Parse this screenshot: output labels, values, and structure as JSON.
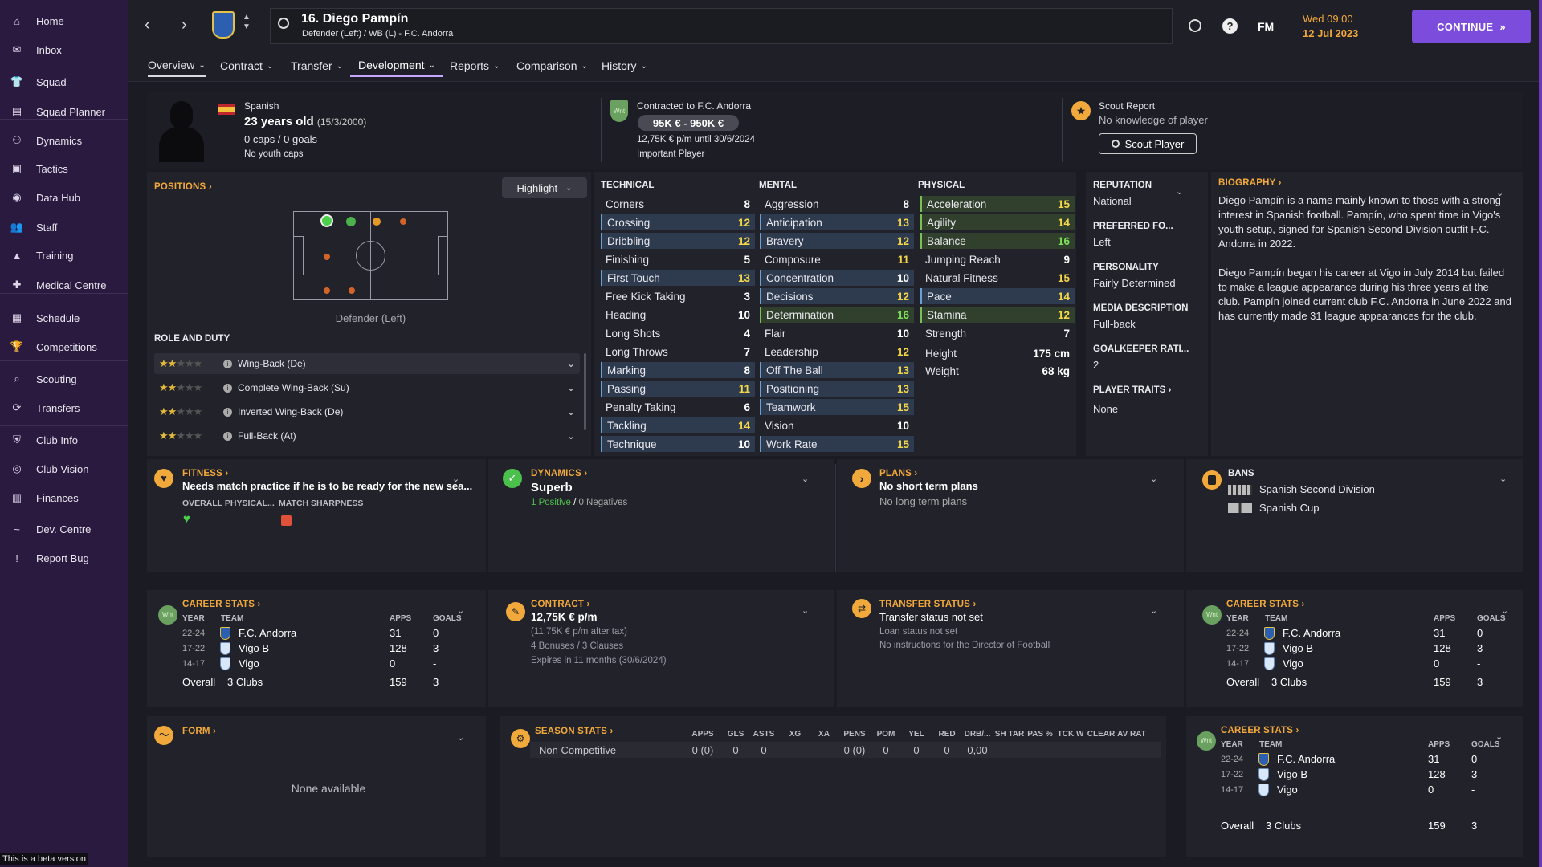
{
  "sidebar": {
    "items": [
      {
        "label": "Home",
        "icon": "home-icon"
      },
      {
        "label": "Inbox",
        "icon": "inbox-icon"
      },
      {
        "label": "Squad",
        "icon": "shirt-icon"
      },
      {
        "label": "Squad Planner",
        "icon": "planner-icon"
      },
      {
        "label": "Dynamics",
        "icon": "dynamics-icon"
      },
      {
        "label": "Tactics",
        "icon": "tactics-icon"
      },
      {
        "label": "Data Hub",
        "icon": "data-hub-icon"
      },
      {
        "label": "Staff",
        "icon": "staff-icon"
      },
      {
        "label": "Training",
        "icon": "training-icon"
      },
      {
        "label": "Medical Centre",
        "icon": "medical-icon"
      },
      {
        "label": "Schedule",
        "icon": "calendar-icon"
      },
      {
        "label": "Competitions",
        "icon": "trophy-icon"
      },
      {
        "label": "Scouting",
        "icon": "scouting-icon"
      },
      {
        "label": "Transfers",
        "icon": "transfers-icon"
      },
      {
        "label": "Club Info",
        "icon": "shield-icon"
      },
      {
        "label": "Club Vision",
        "icon": "vision-icon"
      },
      {
        "label": "Finances",
        "icon": "finances-icon"
      },
      {
        "label": "Dev. Centre",
        "icon": "dev-centre-icon"
      },
      {
        "label": "Report Bug",
        "icon": "bug-icon"
      }
    ],
    "beta": "This is a beta version"
  },
  "header": {
    "player_title": "16. Diego Pampín",
    "player_sub": "Defender (Left) / WB (L) - F.C. Andorra",
    "fm": "FM",
    "date_line1": "Wed 09:00",
    "date_line2": "12 Jul 2023",
    "continue": "CONTINUE"
  },
  "tabs": [
    "Overview",
    "Contract",
    "Transfer",
    "Development",
    "Reports",
    "Comparison",
    "History"
  ],
  "profile": {
    "nationality": "Spanish",
    "age": "23 years old",
    "dob": "(15/3/2000)",
    "caps": "0 caps / 0 goals",
    "youth": "No youth caps"
  },
  "contract_box": {
    "title": "Contracted to F.C. Andorra",
    "value": "95K € - 950K €",
    "wage": "12,75K € p/m until 30/6/2024",
    "status": "Important Player",
    "badge": "Wnt"
  },
  "scout": {
    "title": "Scout Report",
    "text": "No knowledge of player",
    "button": "Scout Player"
  },
  "positions": {
    "title": "POSITIONS",
    "highlight": "Highlight",
    "label": "Defender (Left)"
  },
  "role": {
    "title": "ROLE AND DUTY",
    "items": [
      {
        "label": "Wing-Back (De)",
        "stars": 2
      },
      {
        "label": "Complete Wing-Back (Su)",
        "stars": 2
      },
      {
        "label": "Inverted Wing-Back (De)",
        "stars": 2
      },
      {
        "label": "Full-Back (At)",
        "stars": 2
      }
    ]
  },
  "technical": {
    "title": "TECHNICAL",
    "rows": [
      [
        "Corners",
        "8"
      ],
      [
        "Crossing",
        "12"
      ],
      [
        "Dribbling",
        "12"
      ],
      [
        "Finishing",
        "5"
      ],
      [
        "First Touch",
        "13"
      ],
      [
        "Free Kick Taking",
        "3"
      ],
      [
        "Heading",
        "10"
      ],
      [
        "Long Shots",
        "4"
      ],
      [
        "Long Throws",
        "7"
      ],
      [
        "Marking",
        "8"
      ],
      [
        "Passing",
        "11"
      ],
      [
        "Penalty Taking",
        "6"
      ],
      [
        "Tackling",
        "14"
      ],
      [
        "Technique",
        "10"
      ]
    ]
  },
  "mental": {
    "title": "MENTAL",
    "rows": [
      [
        "Aggression",
        "8"
      ],
      [
        "Anticipation",
        "13"
      ],
      [
        "Bravery",
        "12"
      ],
      [
        "Composure",
        "11"
      ],
      [
        "Concentration",
        "10"
      ],
      [
        "Decisions",
        "12"
      ],
      [
        "Determination",
        "16"
      ],
      [
        "Flair",
        "10"
      ],
      [
        "Leadership",
        "12"
      ],
      [
        "Off The Ball",
        "13"
      ],
      [
        "Positioning",
        "13"
      ],
      [
        "Teamwork",
        "15"
      ],
      [
        "Vision",
        "10"
      ],
      [
        "Work Rate",
        "15"
      ]
    ]
  },
  "physical": {
    "title": "PHYSICAL",
    "rows": [
      [
        "Acceleration",
        "15"
      ],
      [
        "Agility",
        "14"
      ],
      [
        "Balance",
        "16"
      ],
      [
        "Jumping Reach",
        "9"
      ],
      [
        "Natural Fitness",
        "15"
      ],
      [
        "Pace",
        "14"
      ],
      [
        "Stamina",
        "12"
      ],
      [
        "Strength",
        "7"
      ]
    ],
    "height_label": "Height",
    "height": "175 cm",
    "weight_label": "Weight",
    "weight": "68 kg"
  },
  "info": {
    "rep_t": "REPUTATION",
    "rep": "National",
    "foot_t": "PREFERRED FO...",
    "foot": "Left",
    "pers_t": "PERSONALITY",
    "pers": "Fairly Determined",
    "media_t": "MEDIA DESCRIPTION",
    "media": "Full-back",
    "gk_t": "GOALKEEPER RATI...",
    "gk": "2",
    "traits_t": "PLAYER TRAITS",
    "traits": "None"
  },
  "bio": {
    "title": "BIOGRAPHY",
    "p1": "Diego Pampín is a name mainly known to those with a strong interest in Spanish football. Pampín, who spent time in Vigo's youth setup, signed for Spanish Second Division outfit F.C. Andorra in 2022.",
    "p2": "Diego Pampín began his career at Vigo in July 2014 but failed to make a league appearance during his three years at the club. Pampín joined current club F.C. Andorra in June 2022 and has currently made 31 league appearances for the club."
  },
  "fitness": {
    "title": "FITNESS",
    "text": "Needs match practice if he is to be ready for the new sea...",
    "l1": "OVERALL PHYSICAL...",
    "l2": "MATCH SHARPNESS"
  },
  "dynamics": {
    "title": "DYNAMICS",
    "value": "Superb",
    "pos": "1 Positive",
    "sep": "/",
    "neg": "0 Negatives"
  },
  "plans": {
    "title": "PLANS",
    "l1": "No short term plans",
    "l2": "No long term plans"
  },
  "bans": {
    "title": "BANS",
    "items": [
      "Spanish Second Division",
      "Spanish Cup"
    ]
  },
  "career": {
    "title": "CAREER STATS",
    "h_year": "YEAR",
    "h_team": "TEAM",
    "h_apps": "APPS",
    "h_goals": "GOALS",
    "rows": [
      [
        "22-24",
        "F.C. Andorra",
        "31",
        "0"
      ],
      [
        "17-22",
        "Vigo B",
        "128",
        "3"
      ],
      [
        "14-17",
        "Vigo",
        "0",
        "-"
      ]
    ],
    "overall": "Overall",
    "clubs": "3 Clubs",
    "tot_apps": "159",
    "tot_goals": "3",
    "badge": "Wnt"
  },
  "contract": {
    "title": "CONTRACT",
    "wage": "12,75K € p/m",
    "after_tax": "(11,75K € p/m after tax)",
    "bonuses": "4 Bonuses / 3 Clauses",
    "expires": "Expires in 11 months (30/6/2024)"
  },
  "transfer": {
    "title": "TRANSFER STATUS",
    "l1": "Transfer status not set",
    "l2": "Loan status not set",
    "l3": "No instructions for the Director of Football"
  },
  "form": {
    "title": "FORM",
    "text": "None available"
  },
  "season": {
    "title": "SEASON STATS",
    "headers": [
      "APPS",
      "GLS",
      "ASTS",
      "XG",
      "XA",
      "PENS",
      "POM",
      "YEL",
      "RED",
      "DRB/...",
      "SH TAR",
      "PAS %",
      "TCK W",
      "CLEAR",
      "AV RAT"
    ],
    "comp": "Non Competitive",
    "values": [
      "0 (0)",
      "0",
      "0",
      "-",
      "-",
      "0 (0)",
      "0",
      "0",
      "0",
      "0,00",
      "-",
      "-",
      "-",
      "-",
      "-"
    ]
  },
  "colors": {
    "accent": "#f2a93b",
    "purple": "#7c4ddd",
    "sidebar": "#2a1a40"
  }
}
